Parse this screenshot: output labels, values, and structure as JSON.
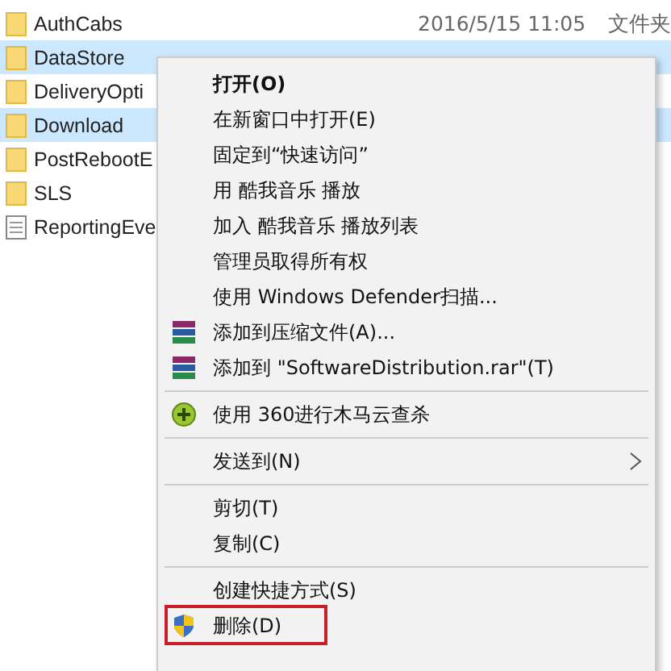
{
  "files": [
    {
      "name": "AuthCabs",
      "kind": "folder",
      "selected": false,
      "date": "2016/5/15 11:05",
      "type": "文件夹"
    },
    {
      "name": "DataStore",
      "kind": "folder",
      "selected": true
    },
    {
      "name": "DeliveryOpti",
      "kind": "folder",
      "selected": false
    },
    {
      "name": "Download",
      "kind": "folder",
      "selected": true
    },
    {
      "name": "PostRebootE",
      "kind": "folder",
      "selected": false
    },
    {
      "name": "SLS",
      "kind": "folder",
      "selected": false
    },
    {
      "name": "ReportingEve",
      "kind": "file",
      "selected": false
    }
  ],
  "context_menu": {
    "items": [
      {
        "kind": "item",
        "label": "打开(O)",
        "bold": true
      },
      {
        "kind": "item",
        "label": "在新窗口中打开(E)"
      },
      {
        "kind": "item",
        "label": "固定到“快速访问”"
      },
      {
        "kind": "item",
        "label": "用 酷我音乐 播放"
      },
      {
        "kind": "item",
        "label": "加入 酷我音乐 播放列表"
      },
      {
        "kind": "item",
        "label": "管理员取得所有权"
      },
      {
        "kind": "item",
        "label": "使用 Windows Defender扫描..."
      },
      {
        "kind": "archive",
        "label": "添加到压缩文件(A)..."
      },
      {
        "kind": "archive",
        "label": "添加到 \"SoftwareDistribution.rar\"(T)"
      },
      {
        "kind": "separator"
      },
      {
        "kind": "scan",
        "label": "使用 360进行木马云查杀"
      },
      {
        "kind": "separator"
      },
      {
        "kind": "submenu",
        "label": "发送到(N)"
      },
      {
        "kind": "separator"
      },
      {
        "kind": "item",
        "label": "剪切(T)"
      },
      {
        "kind": "item",
        "label": "复制(C)"
      },
      {
        "kind": "separator"
      },
      {
        "kind": "item",
        "label": "创建快捷方式(S)"
      },
      {
        "kind": "shield",
        "label": "删除(D)",
        "highlighted": true
      }
    ]
  }
}
